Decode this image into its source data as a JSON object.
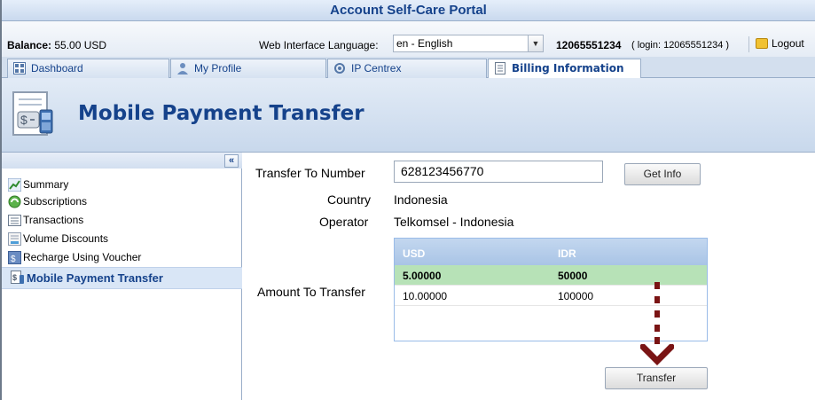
{
  "app": {
    "title": "Account Self-Care Portal"
  },
  "infobar": {
    "balance_label": "Balance:",
    "balance_value": "55.00 USD",
    "language_label": "Web Interface Language:",
    "language_value": "en - English",
    "account_number": "12065551234",
    "login_info": "( login: 12065551234 )",
    "logout_label": "Logout"
  },
  "tabs": [
    {
      "label": "Dashboard",
      "icon": "dashboard-icon"
    },
    {
      "label": "My Profile",
      "icon": "user-icon"
    },
    {
      "label": "IP Centrex",
      "icon": "network-icon"
    },
    {
      "label": "Billing Information",
      "icon": "document-icon",
      "active": true
    }
  ],
  "page": {
    "title": "Mobile Payment Transfer",
    "icon": "mobile-payment-icon"
  },
  "sidebar": {
    "collapse_label": "«",
    "items": [
      {
        "label": "Summary",
        "icon": "chart-icon"
      },
      {
        "label": "Subscriptions",
        "icon": "recycle-icon"
      },
      {
        "label": "Transactions",
        "icon": "list-icon"
      },
      {
        "label": "Volume Discounts",
        "icon": "discount-icon"
      },
      {
        "label": "Recharge Using Voucher",
        "icon": "voucher-icon"
      },
      {
        "label": "Mobile Payment Transfer",
        "icon": "mobile-payment-icon",
        "active": true
      }
    ]
  },
  "form": {
    "transfer_to_label": "Transfer To Number",
    "transfer_to_value": "628123456770",
    "get_info_label": "Get Info",
    "country_label": "Country",
    "country_value": "Indonesia",
    "operator_label": "Operator",
    "operator_value": "Telkomsel - Indonesia",
    "amount_label": "Amount To Transfer",
    "transfer_label": "Transfer"
  },
  "amount_grid": {
    "columns": [
      "USD",
      "IDR"
    ],
    "rows": [
      [
        "5.00000",
        "50000"
      ],
      [
        "10.00000",
        "100000"
      ]
    ],
    "selected_row": 0
  },
  "colors": {
    "accent": "#15428b",
    "arrow": "#7a1414",
    "selected": "#b7e2b7"
  }
}
